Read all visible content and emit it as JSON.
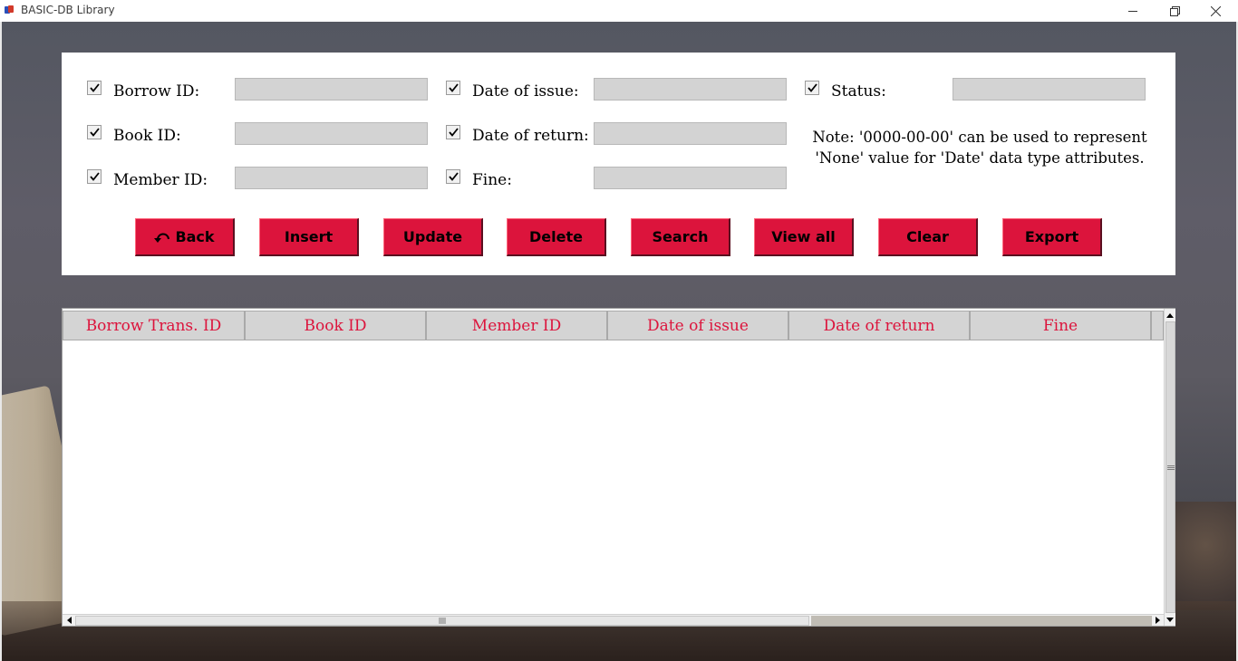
{
  "window": {
    "title": "BASIC-DB Library"
  },
  "form": {
    "fields": [
      {
        "label": "Borrow ID:",
        "checked": true,
        "value": ""
      },
      {
        "label": "Book ID:",
        "checked": true,
        "value": ""
      },
      {
        "label": "Member ID:",
        "checked": true,
        "value": ""
      },
      {
        "label": "Date of issue:",
        "checked": true,
        "value": ""
      },
      {
        "label": "Date of return:",
        "checked": true,
        "value": ""
      },
      {
        "label": "Fine:",
        "checked": true,
        "value": ""
      },
      {
        "label": "Status:",
        "checked": true,
        "value": ""
      }
    ],
    "note": "Note: '0000-00-00' can be used to represent 'None' value for 'Date' data type attributes."
  },
  "buttons": {
    "back": "Back",
    "insert": "Insert",
    "update": "Update",
    "delete": "Delete",
    "search": "Search",
    "view_all": "View all",
    "clear": "Clear",
    "export": "Export"
  },
  "table": {
    "columns": [
      "Borrow Trans. ID",
      "Book ID",
      "Member ID",
      "Date of issue",
      "Date of return",
      "Fine"
    ],
    "rows": []
  },
  "colors": {
    "accent": "#dc143c",
    "field_bg": "#d3d3d3",
    "header_bg": "#d4d4d4"
  }
}
